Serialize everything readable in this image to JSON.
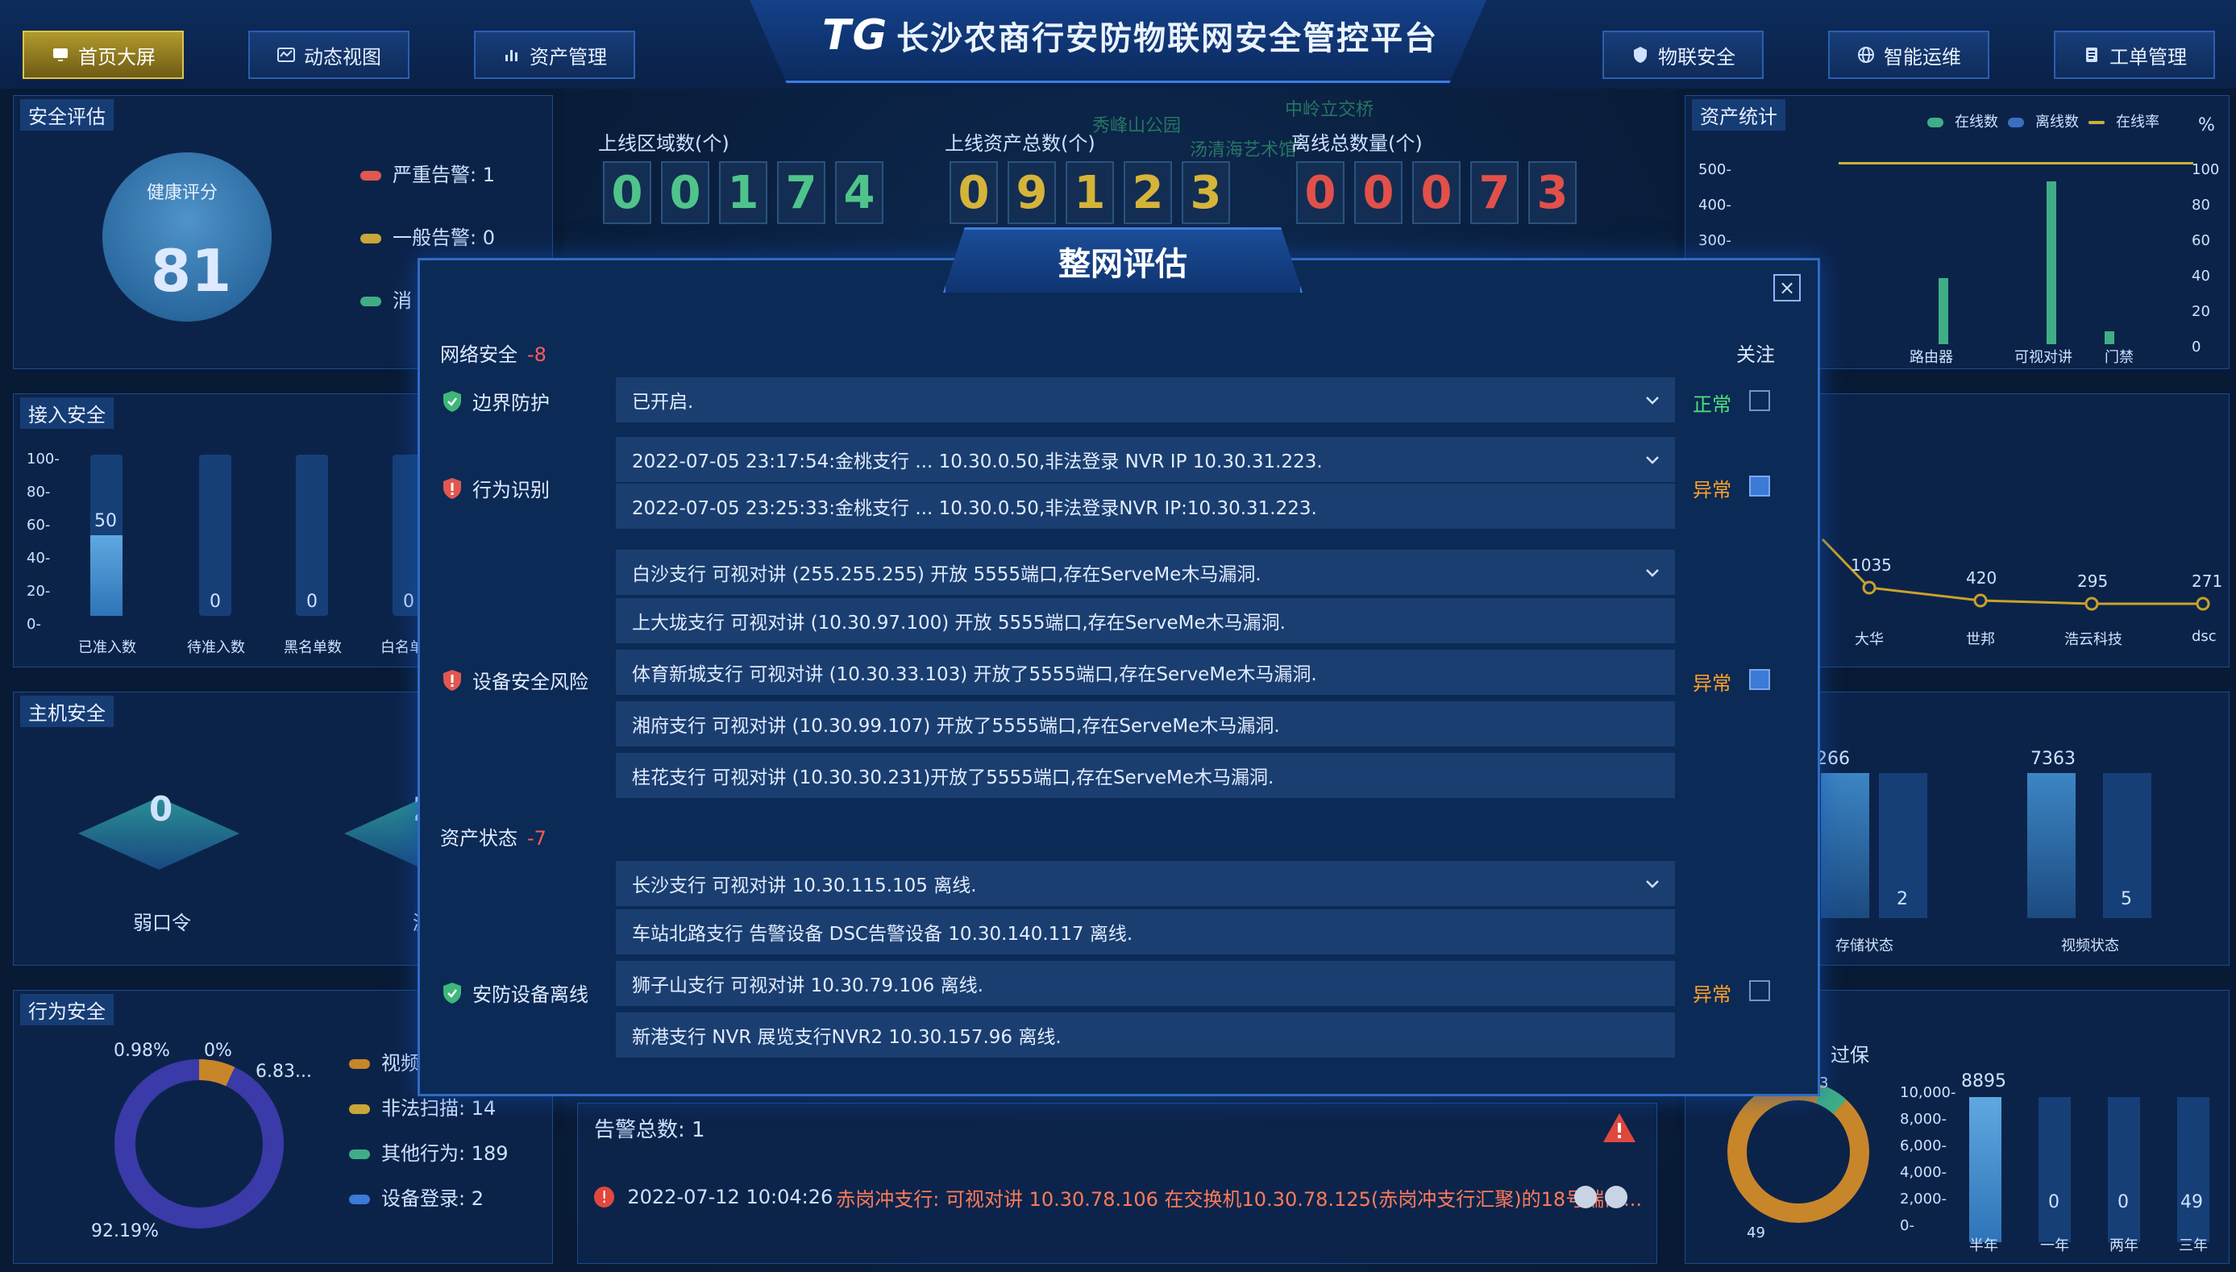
{
  "header": {
    "logo": "TG",
    "title": "长沙农商行安防物联网安全管控平台",
    "nav_left": [
      "首页大屏",
      "动态视图",
      "资产管理"
    ],
    "nav_right": [
      "物联安全",
      "智能运维",
      "工单管理"
    ]
  },
  "counters": {
    "region_label": "上线区域数(个)",
    "region_digits": [
      "0",
      "0",
      "1",
      "7",
      "4"
    ],
    "asset_label": "上线资产总数(个)",
    "asset_digits": [
      "0",
      "9",
      "1",
      "2",
      "3"
    ],
    "offline_label": "离线总数量(个)",
    "offline_digits": [
      "0",
      "0",
      "0",
      "7",
      "3"
    ]
  },
  "map_labels": [
    "秀峰山公园",
    "中岭立交桥",
    "汤清海艺术馆"
  ],
  "panels": {
    "safety_eval": {
      "title": "安全评估",
      "health_label": "健康评分",
      "health_score": "81",
      "legend": [
        "严重告警: 1",
        "一般告警: 0",
        "消"
      ]
    },
    "access": {
      "title": "接入安全",
      "yticks": [
        "100-",
        "80-",
        "60-",
        "40-",
        "20-",
        "0-"
      ],
      "bars": [
        {
          "label": "已准入数",
          "value": "50"
        },
        {
          "label": "待准入数",
          "value": "0"
        },
        {
          "label": "黑名单数",
          "value": "0"
        },
        {
          "label": "白名单数",
          "value": "0"
        }
      ]
    },
    "host": {
      "title": "主机安全",
      "items": [
        {
          "label": "弱口令",
          "value": "0"
        },
        {
          "label": "漏",
          "value": "2"
        }
      ]
    },
    "behavior": {
      "title": "行为安全",
      "pcts": [
        "0.98%",
        "0%",
        "6.83...",
        "92.19%"
      ],
      "legend": [
        "视频",
        "非法扫描: 14",
        "其他行为: 189",
        "设备登录: 2"
      ]
    },
    "asset_stats": {
      "title": "资产统计",
      "legend": [
        "在线数",
        "离线数",
        "在线率"
      ],
      "unit": "%",
      "yticks_left": [
        "500-",
        "400-",
        "300-"
      ],
      "yticks_right": [
        "100",
        "80",
        "60",
        "40",
        "20",
        "0"
      ],
      "xlabels": [
        "路由器",
        "可视对讲",
        "门禁"
      ]
    },
    "right_mid": {
      "values": [
        "1035",
        "420",
        "295",
        "271"
      ],
      "xlabels": [
        "大华",
        "世邦",
        "浩云科技",
        "dsc"
      ]
    },
    "right_lower": {
      "values": [
        "266",
        "2",
        "7363",
        "5"
      ],
      "xlabels": [
        "存储状态",
        "视频状态"
      ]
    },
    "right_bottom": {
      "title": "过保",
      "yticks": [
        "10,000-",
        "8,000-",
        "6,000-",
        "4,000-",
        "2,000-",
        "0-"
      ],
      "bars": [
        {
          "label": "半年",
          "value": "8895"
        },
        {
          "label": "一年",
          "value": "0"
        },
        {
          "label": "两年",
          "value": "0"
        },
        {
          "label": "三年",
          "value": "49"
        }
      ],
      "ring_labels": [
        "3",
        "49"
      ]
    }
  },
  "alarms": {
    "total_label": "告警总数: 1",
    "item_text": "2022-07-12 10:04:26",
    "item_desc": "赤岗冲支行: 可视对讲 10.30.78.106 在交换机10.30.78.125(赤岗冲支行汇聚)的18号端口..."
  },
  "modal": {
    "title": "整网评估",
    "close": "×",
    "follow": "关注",
    "net_security_label": "网络安全",
    "net_security_score": "-8",
    "asset_state_label": "资产状态",
    "asset_state_score": "-7",
    "rows": {
      "border": {
        "label": "边界防护",
        "status": "正常",
        "text": "已开启."
      },
      "behavior": {
        "label": "行为识别",
        "status": "异常",
        "lines": [
          "2022-07-05 23:17:54:金桃支行 ... 10.30.0.50,非法登录 NVR IP 10.30.31.223.",
          "2022-07-05 23:25:33:金桃支行 ... 10.30.0.50,非法登录NVR IP:10.30.31.223."
        ]
      },
      "device_risk": {
        "label": "设备安全风险",
        "status": "异常",
        "lines": [
          "白沙支行 可视对讲 (255.255.255) 开放 5555端口,存在ServeMe木马漏洞.",
          "上大垅支行 可视对讲 (10.30.97.100) 开放 5555端口,存在ServeMe木马漏洞.",
          "体育新城支行 可视对讲 (10.30.33.103) 开放了5555端口,存在ServeMe木马漏洞.",
          "湘府支行 可视对讲 (10.30.99.107) 开放了5555端口,存在ServeMe木马漏洞.",
          "桂花支行 可视对讲 (10.30.30.231)开放了5555端口,存在ServeMe木马漏洞."
        ]
      },
      "offline": {
        "label": "安防设备离线",
        "status": "异常",
        "lines": [
          "长沙支行 可视对讲 10.30.115.105 离线.",
          "车站北路支行 告警设备 DSC告警设备 10.30.140.117 离线.",
          "狮子山支行 可视对讲 10.30.79.106 离线.",
          "新港支行 NVR 展览支行NVR2 10.30.157.96 离线."
        ]
      }
    }
  },
  "colors": {
    "accent": "#3b7de0",
    "ok": "#4fe07a",
    "warn": "#ffa22a",
    "danger": "#ff5a5a",
    "green_digit": "#4fc48a",
    "yellow_digit": "#d6b43a",
    "red_digit": "#e2504a"
  }
}
